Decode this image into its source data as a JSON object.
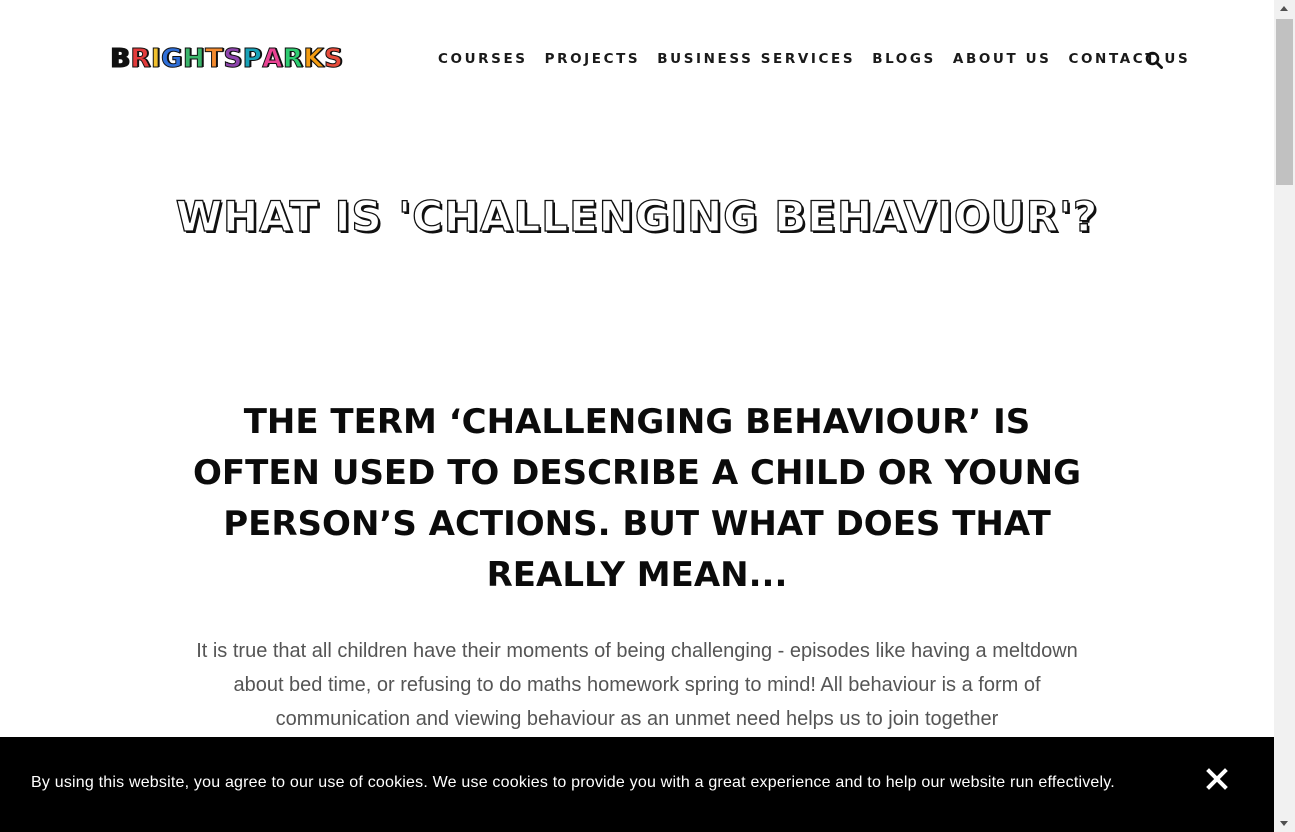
{
  "header": {
    "logo": {
      "letters": [
        {
          "char": "B",
          "color": "#111111"
        },
        {
          "char": "R",
          "color": "#e23b3b"
        },
        {
          "char": "I",
          "color": "#f2c12e"
        },
        {
          "char": "G",
          "color": "#2f6fd8"
        },
        {
          "char": "H",
          "color": "#3bb56b"
        },
        {
          "char": "T",
          "color": "#f28a2e"
        },
        {
          "char": "S",
          "color": "#8e44ad"
        },
        {
          "char": "P",
          "color": "#17a2b8"
        },
        {
          "char": "A",
          "color": "#e84393"
        },
        {
          "char": "R",
          "color": "#2ecc71"
        },
        {
          "char": "K",
          "color": "#f39c12"
        },
        {
          "char": "S",
          "color": "#e74c3c"
        }
      ]
    },
    "nav": [
      {
        "label": "COURSES"
      },
      {
        "label": "PROJECTS"
      },
      {
        "label": "BUSINESS SERVICES"
      },
      {
        "label": "BLOGS"
      },
      {
        "label": "ABOUT US"
      },
      {
        "label": "CONTACT US"
      }
    ],
    "search_icon": "search-icon"
  },
  "main": {
    "title": "WHAT IS 'CHALLENGING BEHAVIOUR'?",
    "subheading": "THE TERM ‘CHALLENGING BEHAVIOUR’ IS OFTEN USED TO DESCRIBE A CHILD OR YOUNG PERSON’S ACTIONS. BUT WHAT DOES THAT REALLY MEAN...",
    "body": "It is true that all children have their moments of being challenging - episodes like having a meltdown about bed time, or refusing to do maths homework spring to mind! All behaviour is a form of communication and viewing behaviour as an unmet need helps us to join together"
  },
  "cookie_bar": {
    "text": "By using this website, you agree to our use of cookies. We use cookies to provide you with a great experience and to help our website run effectively.",
    "close_icon": "close-icon"
  }
}
